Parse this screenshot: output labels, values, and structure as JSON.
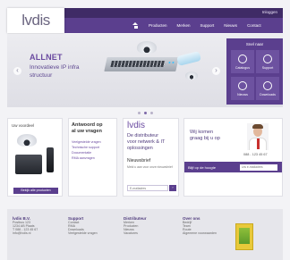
{
  "theme": {
    "purple": "#5b3f8e",
    "purple_dark": "#3f2b66",
    "gray_bg": "#e6e6eb"
  },
  "header": {
    "logo": "lvdis",
    "top_link": "Inloggen",
    "nav": {
      "home_icon": "home-icon",
      "items": [
        "Producten",
        "Merken",
        "Support",
        "Nieuws",
        "Contact"
      ]
    }
  },
  "hero": {
    "title": "ALLNET",
    "subtitle_1": "Innovatieve IP infra",
    "subtitle_2": "structuur",
    "prev_icon": "chevron-left-icon",
    "next_icon": "chevron-right-icon",
    "prev_glyph": "‹",
    "next_glyph": "›",
    "slide_count": 3
  },
  "quick_links": {
    "title": "Snel naar",
    "tiles": [
      {
        "label": "Catalogus",
        "icon": "catalog-icon"
      },
      {
        "label": "Support",
        "icon": "support-icon"
      },
      {
        "label": "Nieuws",
        "icon": "news-icon"
      },
      {
        "label": "Downloads",
        "icon": "download-icon"
      }
    ]
  },
  "cards": {
    "benefit": {
      "title": "Uw voordeel",
      "button": "Bekijk alle producten"
    },
    "faq": {
      "title_1": "Antwoord op",
      "title_2": "al uw vragen",
      "links": [
        "Veelgestelde vragen",
        "Technische support",
        "Documentatie",
        "RMA aanvragen"
      ]
    },
    "about": {
      "logo": "lvdis",
      "line_1": "De distributeur",
      "line_2": "voor netwerk & IT",
      "line_3": "oplossingen",
      "newsletter_title": "Nieuwsbrief",
      "newsletter_text": "Meld u aan voor onze nieuwsbrief",
      "newsletter_placeholder": "E-mailadres",
      "newsletter_button": "›"
    },
    "contact": {
      "line_1": "Wij komen",
      "line_2": "graag bij u op",
      "phone": "088 - 123 45 67",
      "bar_text": "Blijf op de hoogte",
      "bar_placeholder": "Uw e-mailadres"
    }
  },
  "footer": {
    "columns": [
      {
        "title": "lvdis B.V.",
        "items": [
          "Postbus 123",
          "1234 AB Plaats",
          "T 088 - 123 45 67",
          "info@lvdis.nl"
        ]
      },
      {
        "title": "Support",
        "items": [
          "Contact",
          "RMA",
          "Downloads",
          "Veelgestelde vragen"
        ]
      },
      {
        "title": "Distributeur",
        "items": [
          "Merken",
          "Producten",
          "Nieuws",
          "Vacatures"
        ]
      },
      {
        "title": "Over ons",
        "items": [
          "Bedrijf",
          "Team",
          "Route",
          "Algemene voorwaarden"
        ]
      }
    ],
    "badge_icon": "award-badge-icon"
  }
}
